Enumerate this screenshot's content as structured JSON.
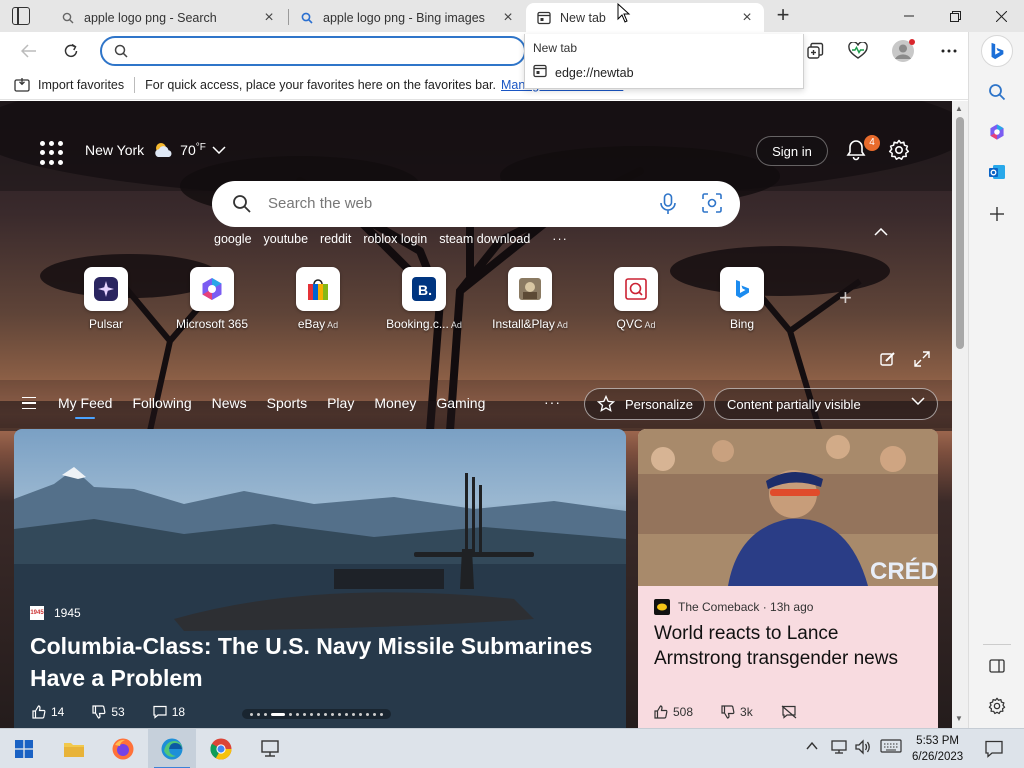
{
  "tabs": [
    {
      "title": "apple logo png - Search",
      "icon": "search-icon"
    },
    {
      "title": "apple logo png - Bing images",
      "icon": "search-icon"
    },
    {
      "title": "New tab",
      "icon": "newtab-page-icon",
      "active": true
    }
  ],
  "address": {
    "value": "",
    "placeholder": ""
  },
  "omnibox_dropdown": {
    "heading": "New tab",
    "item": "edge://newtab"
  },
  "favorites_bar": {
    "import_label": "Import favorites",
    "message": "For quick access, place your favorites here on the favorites bar.",
    "manage_link": "Manage favorites now"
  },
  "ntp": {
    "weather": {
      "city": "New York",
      "temp": "70",
      "unit": "°F"
    },
    "sign_in": "Sign in",
    "notifications_count": "4",
    "search_placeholder": "Search the web",
    "trending": [
      "google",
      "youtube",
      "reddit",
      "roblox login",
      "steam download"
    ],
    "trending_more": "···",
    "quick_links": [
      {
        "label": "Pulsar",
        "ad": ""
      },
      {
        "label": "Microsoft 365",
        "ad": ""
      },
      {
        "label": "eBay",
        "ad": "Ad"
      },
      {
        "label": "Booking.c...",
        "ad": "Ad"
      },
      {
        "label": "Install&Play",
        "ad": "Ad"
      },
      {
        "label": "QVC",
        "ad": "Ad"
      },
      {
        "label": "Bing",
        "ad": ""
      }
    ],
    "feed_tabs": [
      "My Feed",
      "Following",
      "News",
      "Sports",
      "Play",
      "Money",
      "Gaming"
    ],
    "feed_more": "···",
    "personalize": "Personalize",
    "visibility": "Content partially visible",
    "main_card": {
      "source": "1945",
      "source_logo": "1945",
      "headline": "Columbia-Class: The U.S. Navy Missile Submarines Have a Problem",
      "likes": "14",
      "dislikes": "53",
      "comments": "18"
    },
    "side_card": {
      "source": "The Comeback · 13h ago",
      "headline": "World reacts to Lance Armstrong transgender news",
      "likes": "508",
      "dislikes": "3k"
    }
  },
  "taskbar": {
    "time": "5:53 PM",
    "date": "6/26/2023"
  },
  "colors": {
    "accent": "#2f75c9",
    "badge": "#e86b2c",
    "side_card_bg": "#f8dbe0"
  }
}
